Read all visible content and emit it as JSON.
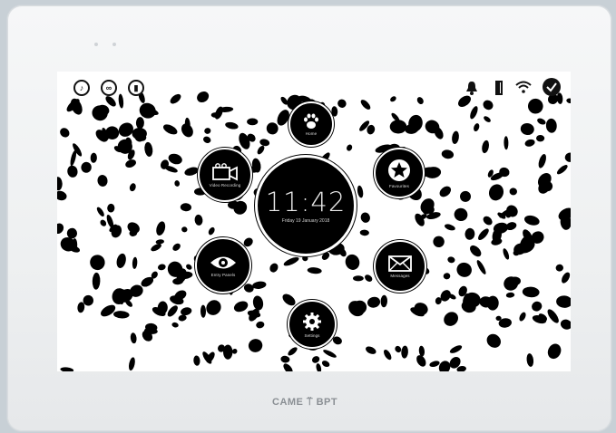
{
  "device": {
    "brand": "CAME ⍡ BPT"
  },
  "status_bar": {
    "left_icons": [
      "do-not-disturb-icon",
      "voicemail-icon",
      "door-status-icon"
    ],
    "right_icons": [
      "bell-icon",
      "door-icon",
      "wifi-icon",
      "check-icon"
    ]
  },
  "clock": {
    "time": "11:42",
    "date": "Friday 19 January 2018"
  },
  "menu": {
    "items": [
      {
        "label": "Home",
        "icon": "paw-icon"
      },
      {
        "label": "Favourites",
        "icon": "star-icon"
      },
      {
        "label": "Messages",
        "icon": "envelope-icon"
      },
      {
        "label": "Settings",
        "icon": "gear-icon"
      },
      {
        "label": "Entry Panels",
        "icon": "eye-icon"
      },
      {
        "label": "Video Recording",
        "icon": "video-camera-icon"
      }
    ]
  },
  "colors": {
    "bezel": "#f2f4f5",
    "screen_bg": "#ffffff",
    "spots": "#000000",
    "brand_text": "#8a8f94"
  }
}
